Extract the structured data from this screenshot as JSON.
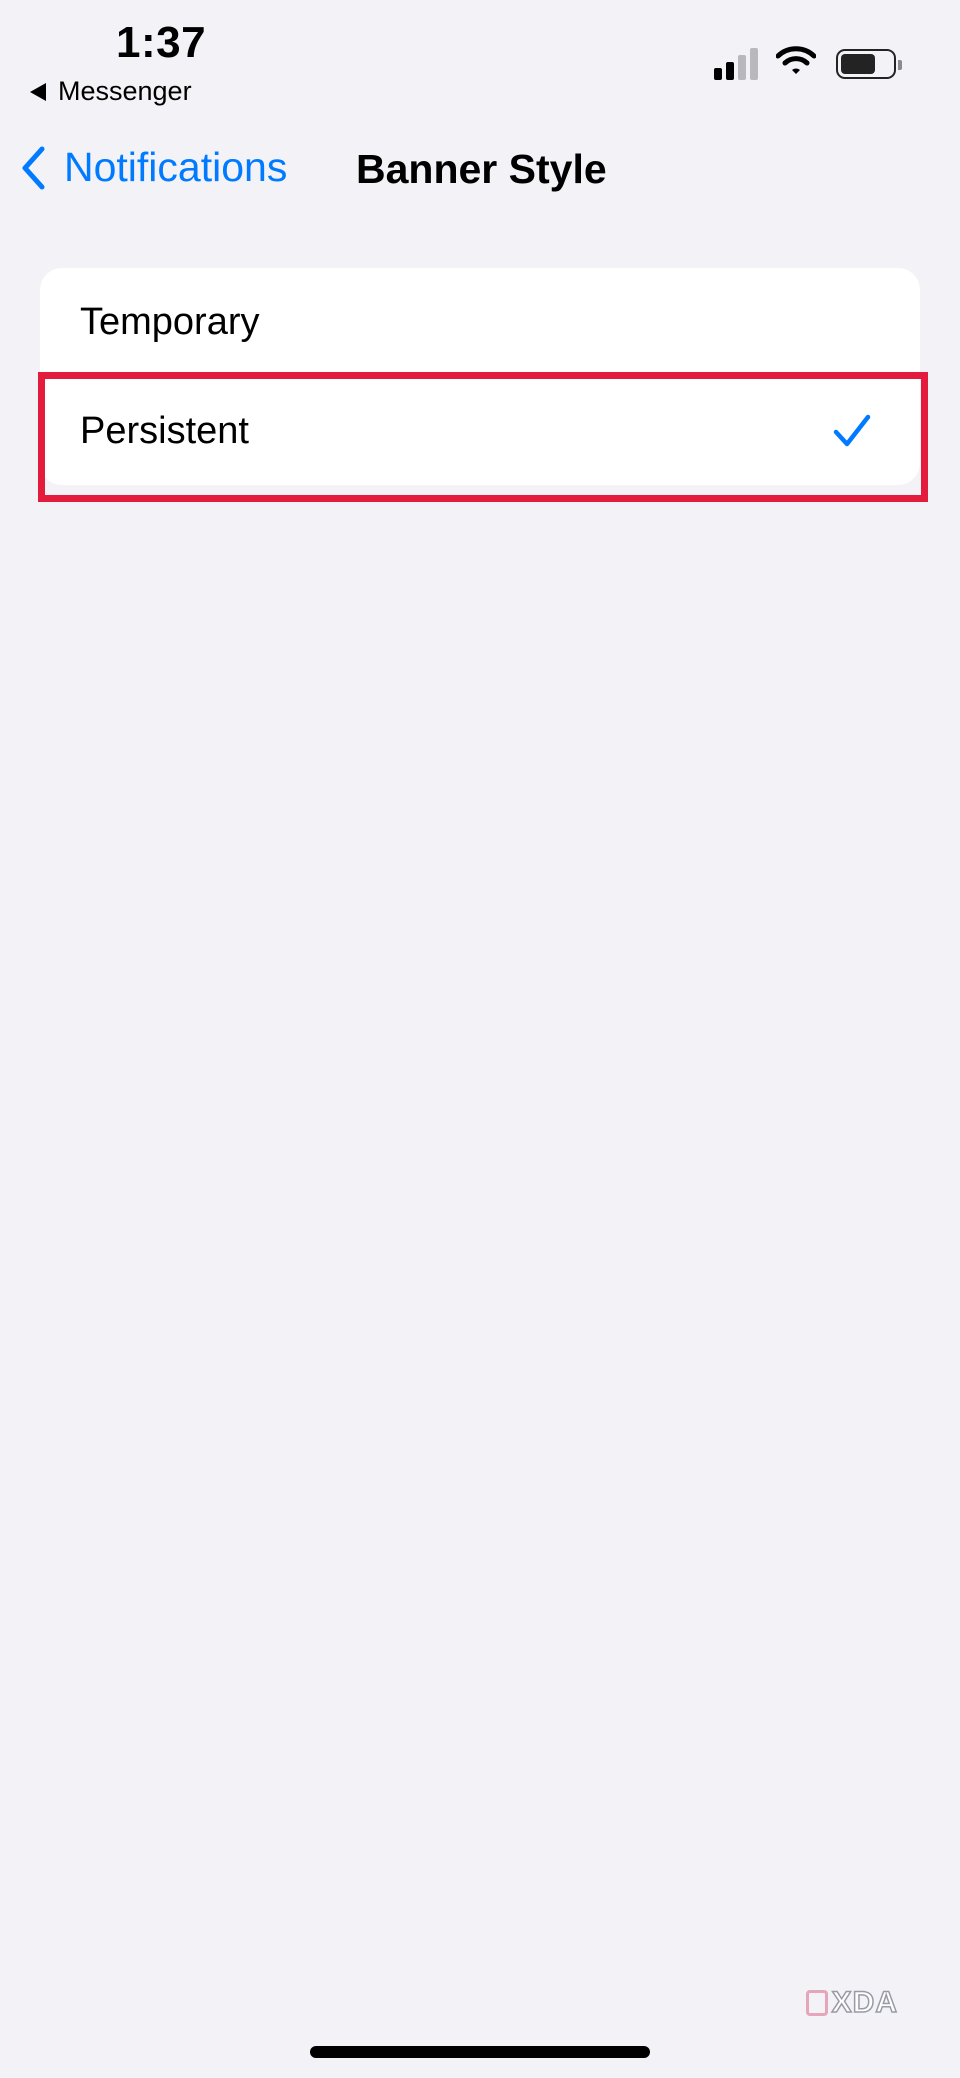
{
  "status_bar": {
    "time": "1:37",
    "back_app": "Messenger"
  },
  "nav": {
    "back_label": "Notifications",
    "title": "Banner Style"
  },
  "options": [
    {
      "label": "Temporary",
      "selected": false
    },
    {
      "label": "Persistent",
      "selected": true
    }
  ],
  "watermark": {
    "text": "XDA"
  },
  "colors": {
    "accent": "#007AFF",
    "highlight": "#E31C3D",
    "background": "#F2F2F7"
  }
}
